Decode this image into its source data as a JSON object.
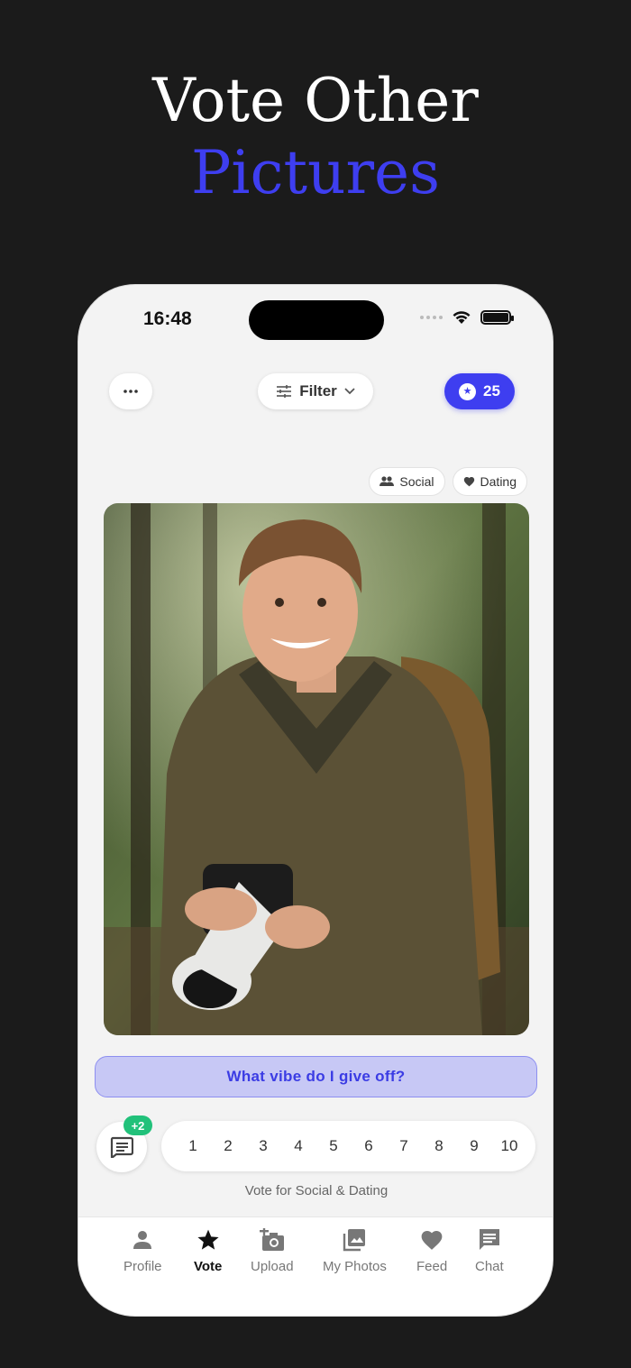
{
  "headline": {
    "line1": "Vote Other",
    "line2": "Pictures"
  },
  "status_bar": {
    "time": "16:48"
  },
  "toolbar": {
    "more_label": "···",
    "filter_label": "Filter",
    "coins": "25"
  },
  "tags": [
    {
      "label": "Social",
      "icon": "people-icon"
    },
    {
      "label": "Dating",
      "icon": "heart-icon"
    }
  ],
  "photo": {
    "description_icon": "photo"
  },
  "vibe_prompt": "What vibe do I give off?",
  "comments": {
    "badge": "+2"
  },
  "rating_scale": [
    "1",
    "2",
    "3",
    "4",
    "5",
    "6",
    "7",
    "8",
    "9",
    "10"
  ],
  "vote_hint": "Vote for Social & Dating",
  "tabs": [
    {
      "label": "Profile",
      "icon": "person-icon"
    },
    {
      "label": "Vote",
      "icon": "star-icon",
      "active": true
    },
    {
      "label": "Upload",
      "icon": "add-photo-icon"
    },
    {
      "label": "My Photos",
      "icon": "photos-icon"
    },
    {
      "label": "Feed",
      "icon": "heart-icon"
    },
    {
      "label": "Chat",
      "icon": "chat-icon"
    }
  ],
  "colors": {
    "accent": "#3e3ef0",
    "badge": "#21c17a",
    "background": "#1b1b1b"
  }
}
